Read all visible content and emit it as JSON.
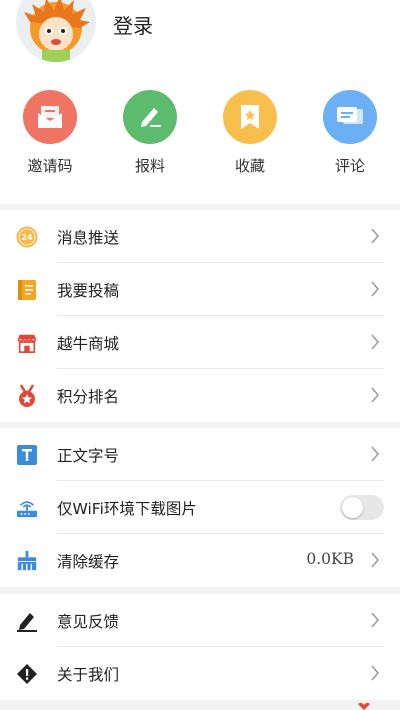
{
  "header": {
    "login_label": "登录"
  },
  "quick_actions": [
    {
      "label": "邀请码",
      "icon": "envelope-icon",
      "color": "#ef7464"
    },
    {
      "label": "报料",
      "icon": "pencil-icon",
      "color": "#5dbb6e"
    },
    {
      "label": "收藏",
      "icon": "bookmark-icon",
      "color": "#f8bf4d"
    },
    {
      "label": "评论",
      "icon": "comment-icon",
      "color": "#6bb0f2"
    }
  ],
  "menu_group_1": [
    {
      "label": "消息推送",
      "icon": "notification-24-icon"
    },
    {
      "label": "我要投稿",
      "icon": "document-icon"
    },
    {
      "label": "越牛商城",
      "icon": "store-icon"
    },
    {
      "label": "积分排名",
      "icon": "medal-icon"
    }
  ],
  "menu_group_2": [
    {
      "label": "正文字号",
      "icon": "text-size-icon"
    },
    {
      "label": "仅WiFi环境下载图片",
      "icon": "wifi-router-icon",
      "toggle": false
    },
    {
      "label": "清除缓存",
      "icon": "broom-icon",
      "value": "0.0KB"
    }
  ],
  "menu_group_3": [
    {
      "label": "意见反馈",
      "icon": "edit-icon"
    },
    {
      "label": "关于我们",
      "icon": "warning-icon"
    }
  ],
  "badge_24": "24"
}
